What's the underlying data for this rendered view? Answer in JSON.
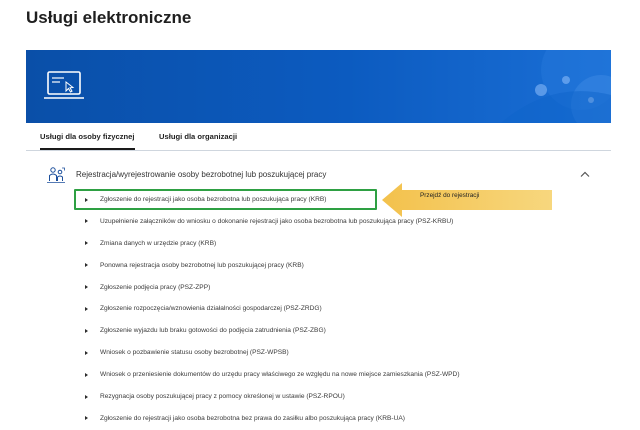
{
  "page": {
    "title": "Usługi elektroniczne"
  },
  "banner": {
    "icon": "laptop-cursor-icon",
    "color": "#0b55b4"
  },
  "tabs": [
    {
      "label": "Usługi dla osoby fizycznej",
      "active": true
    },
    {
      "label": "Usługi dla organizacji",
      "active": false
    }
  ],
  "section": {
    "icon": "people-arrows-icon",
    "title": "Rejestracja/wyrejestrowanie osoby bezrobotnej lub poszukującej pracy",
    "expanded": true
  },
  "items": [
    {
      "label": "Zgłoszenie do rejestracji jako osoba bezrobotna lub poszukująca pracy (KRB)"
    },
    {
      "label": "Uzupełnienie załączników do wniosku o dokonanie rejestracji jako osoba bezrobotna lub poszukująca pracy (PSZ-KRBU)"
    },
    {
      "label": "Zmiana danych w urzędzie pracy (KRB)"
    },
    {
      "label": "Ponowna rejestracja osoby bezrobotnej lub poszukującej pracy (KRB)"
    },
    {
      "label": "Zgłoszenie podjęcia pracy (PSZ-ZPP)"
    },
    {
      "label": "Zgłoszenie rozpoczęcia/wznowienia działalności gospodarczej (PSZ-ZRDG)"
    },
    {
      "label": "Zgłoszenie wyjazdu lub braku gotowości do podjęcia zatrudnienia (PSZ-ZBG)"
    },
    {
      "label": "Wniosek o pozbawienie statusu osoby bezrobotnej (PSZ-WPSB)"
    },
    {
      "label": "Wniosek o przeniesienie dokumentów do urzędu pracy właściwego ze względu na nowe miejsce zamieszkania (PSZ-WPD)"
    },
    {
      "label": "Rezygnacja osoby poszukującej pracy z pomocy określonej w ustawie (PSZ-RPOU)"
    },
    {
      "label": "Zgłoszenie do rejestracji jako osoba bezrobotna bez prawa do zasiłku albo poszukująca pracy (KRB-UA)"
    }
  ],
  "callout": {
    "text": "Przejdź do rejestracji",
    "color": "#f5c95a",
    "highlight_color": "#2ea043"
  }
}
